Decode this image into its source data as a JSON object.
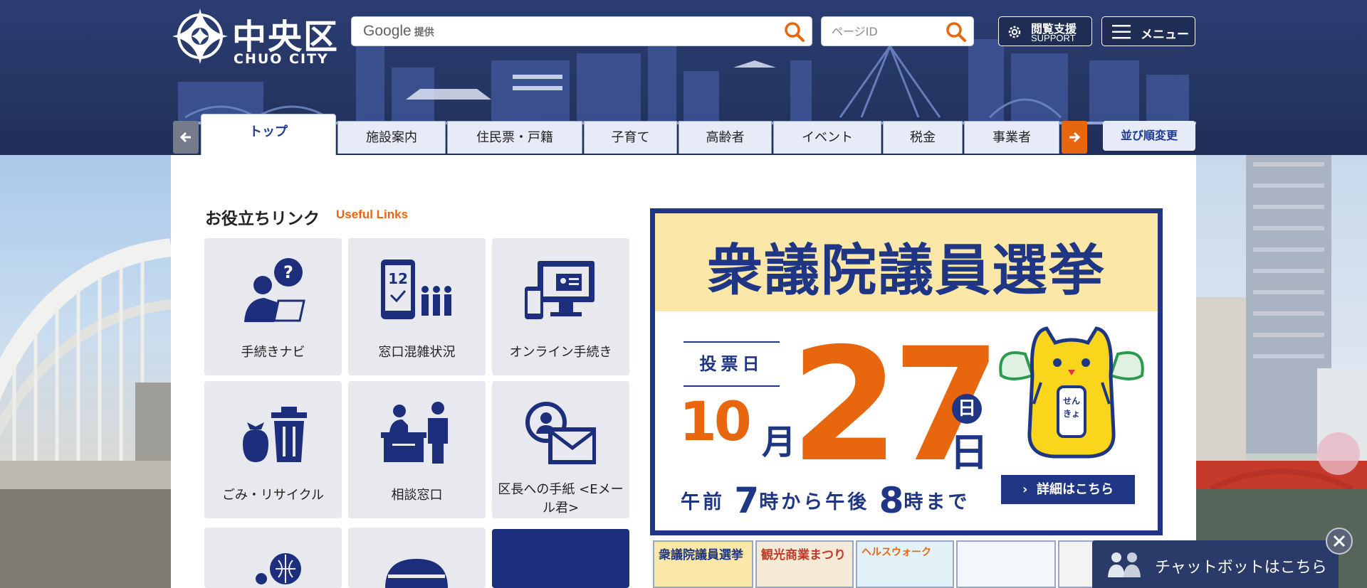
{
  "header": {
    "logo_kanji": "中央区",
    "logo_en": "CHUO CITY",
    "google_search": {
      "brand": "Google",
      "suffix": "提供"
    },
    "page_id_search": {
      "placeholder": "ページID"
    },
    "support_button": {
      "line1": "閲覧支援",
      "line2": "SUPPORT"
    },
    "menu_button": {
      "label": "メニュー"
    }
  },
  "tabs": [
    {
      "label": "トップ",
      "active": true
    },
    {
      "label": "施設案内"
    },
    {
      "label": "住民票・戸籍"
    },
    {
      "label": "子育て"
    },
    {
      "label": "高齢者"
    },
    {
      "label": "イベント"
    },
    {
      "label": "税金"
    },
    {
      "label": "事業者"
    }
  ],
  "sort_button": "並び順変更",
  "useful_links": {
    "title": "お役立ちリンク",
    "subtitle": "Useful Links",
    "items": [
      {
        "label": "手続きナビ",
        "icon": "procedure-navi-icon"
      },
      {
        "label": "窓口混雑状況",
        "icon": "counter-congestion-icon"
      },
      {
        "label": "オンライン手続き",
        "icon": "online-procedure-icon"
      },
      {
        "label": "ごみ・リサイクル",
        "icon": "garbage-recycle-icon"
      },
      {
        "label": "相談窓口",
        "icon": "consultation-icon"
      },
      {
        "label": "区長への手紙 <Eメール君>",
        "icon": "mail-icon"
      }
    ]
  },
  "banner": {
    "title": "衆議院議員選挙",
    "vote_day_label": "投票日",
    "month": "10",
    "month_unit": "月",
    "day": "27",
    "weekday": "日",
    "day_unit": "日",
    "time_prefix": "午前",
    "time_start": "7",
    "time_mid": "時から午後",
    "time_end": "8",
    "time_suffix": "時まで",
    "mascot_text": "せんきょ",
    "detail_button": "詳細はこちら"
  },
  "thumbnails": [
    {
      "label": "衆議院議員選挙"
    },
    {
      "label": "観光商業まつり"
    },
    {
      "label": "ヘルスウォーク"
    },
    {
      "label": ""
    },
    {
      "label": ""
    }
  ],
  "chatbot": {
    "label": "チャットボットはこちら"
  },
  "colors": {
    "navy": "#1f3685",
    "accent": "#e8660d",
    "header": "#253663",
    "tile": "#e8e9ee"
  }
}
